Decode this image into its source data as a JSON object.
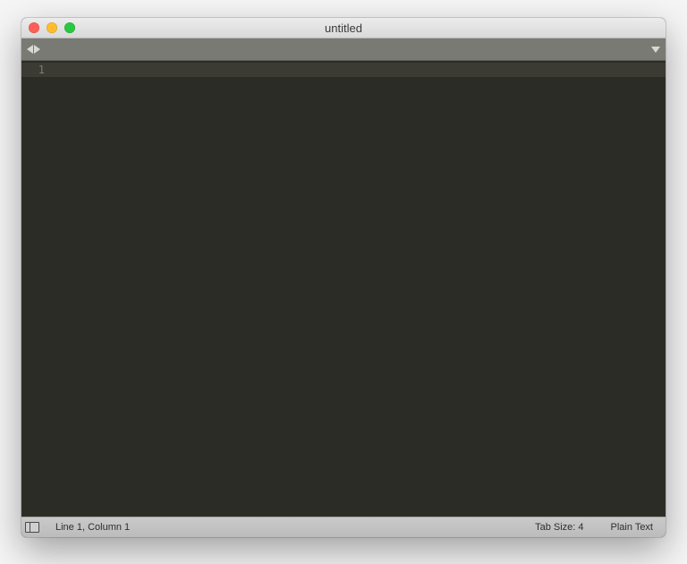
{
  "titlebar": {
    "title": "untitled"
  },
  "editor": {
    "line_numbers": [
      "1"
    ]
  },
  "statusbar": {
    "cursor_position": "Line 1, Column 1",
    "tab_size": "Tab Size: 4",
    "syntax": "Plain Text"
  }
}
